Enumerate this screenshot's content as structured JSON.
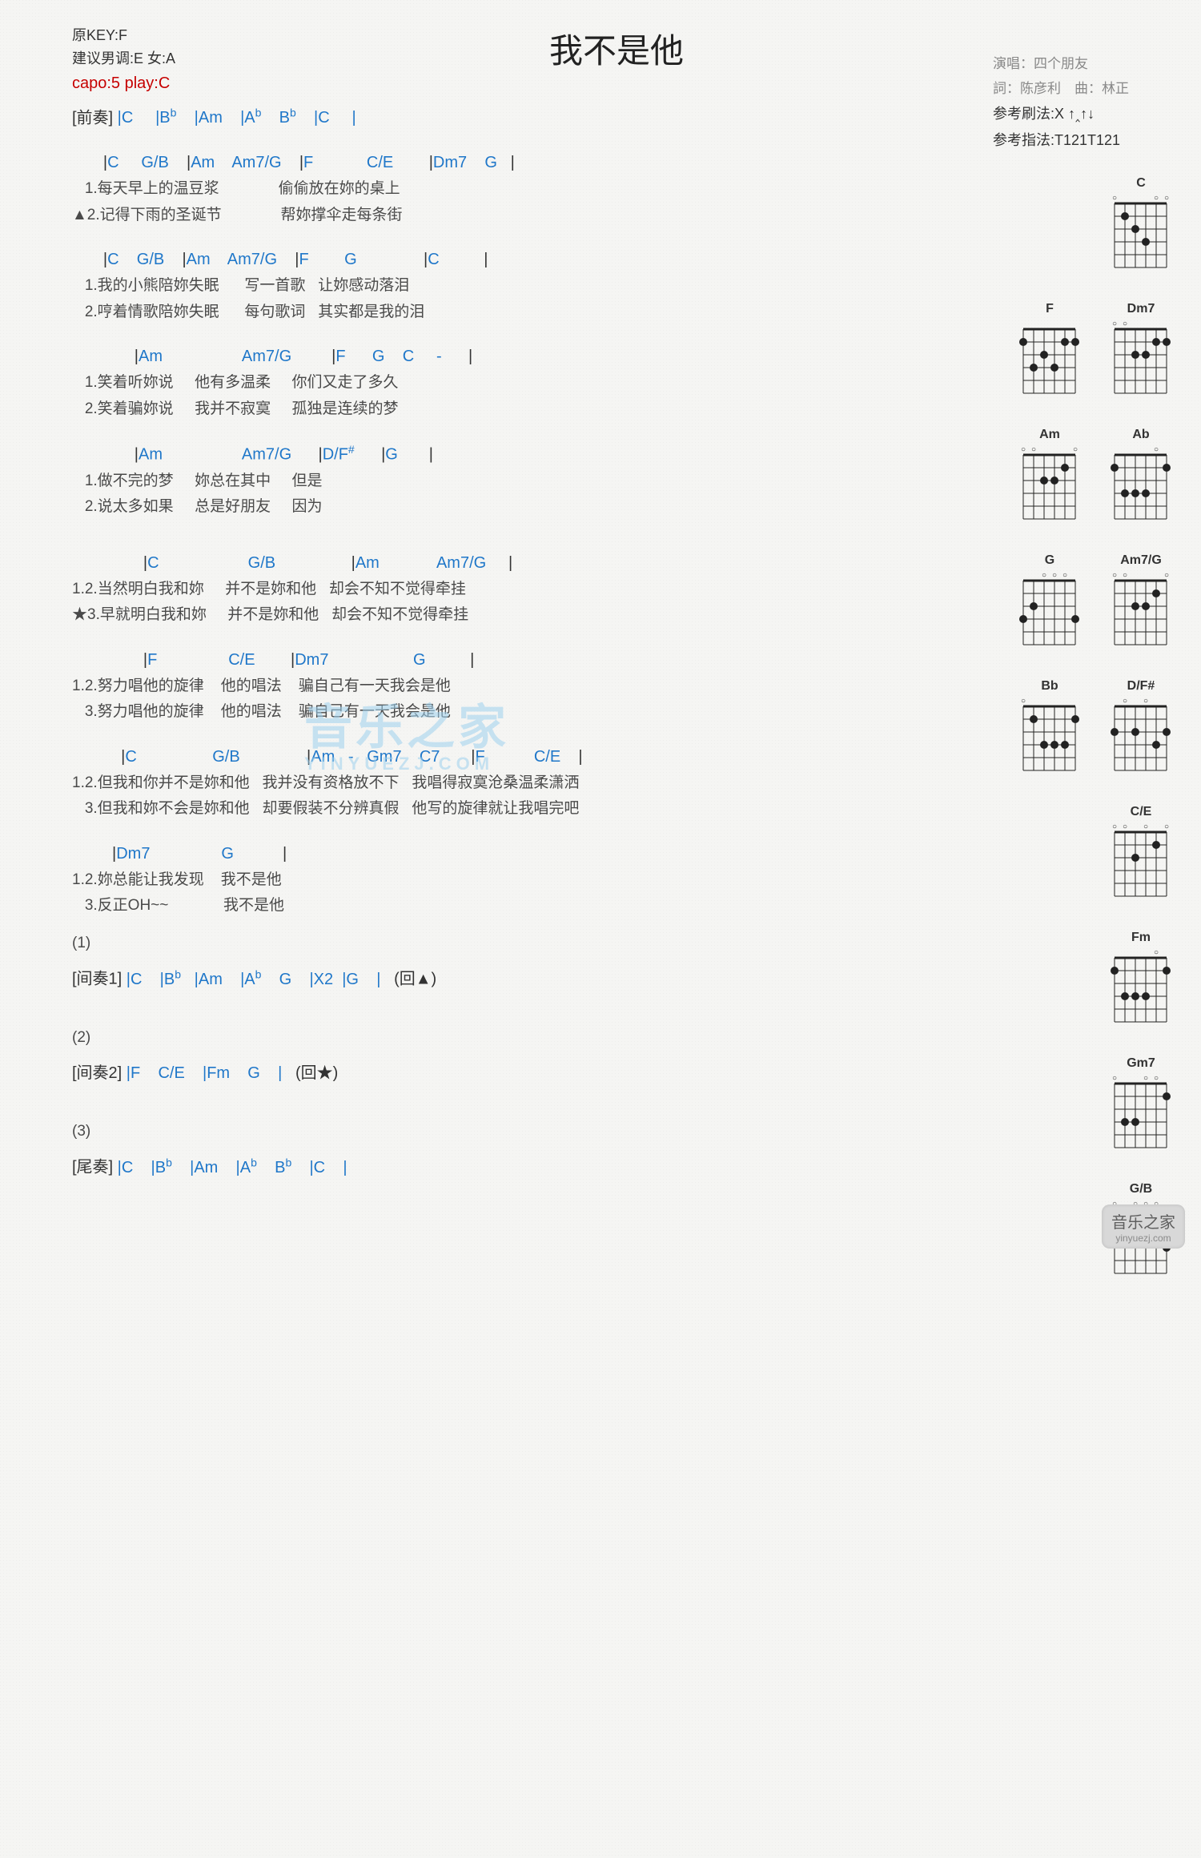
{
  "title": "我不是他",
  "meta": {
    "orig_key": "原KEY:F",
    "suggest": "建议男调:E 女:A",
    "capo": "capo:5 play:C",
    "singer_label": "演唱：",
    "singer": "四个朋友",
    "lyric_label": "詞：",
    "lyricist": "陈彦利",
    "comp_label": "曲：",
    "composer": "林正",
    "strum_label": "参考刷法:",
    "strum": "X ↑‸↑↓",
    "pick_label": "参考指法:",
    "pick": "T121T121"
  },
  "intro_label": "[前奏]",
  "intro_chords": " |C     |B    |Am    |A     B     |C     |",
  "lines": [
    {
      "chords": "       |C     G/B    |Am    Am7/G    |F            C/E        |Dm7    G   |",
      "l1": "   1.每天早上的温豆浆              偷偷放在妳的桌上",
      "l2": "▲2.记得下雨的圣诞节              帮妳撑伞走每条街"
    },
    {
      "chords": "       |C    G/B    |Am    Am7/G    |F        G               |C          |",
      "l1": "   1.我的小熊陪妳失眠      写一首歌   让妳感动落泪",
      "l2": "   2.哼着情歌陪妳失眠      每句歌词   其实都是我的泪"
    },
    {
      "chords": "              |Am                  Am7/G         |F      G    C     -      |",
      "l1": "   1.笑着听妳说     他有多温柔     你们又走了多久",
      "l2": "   2.笑着骗妳说     我并不寂寞     孤独是连续的梦"
    },
    {
      "chords": "              |Am                  Am7/G      |D/F#      |G       |",
      "l1": "   1.做不完的梦     妳总在其中     但是",
      "l2": "   2.说太多如果     总是好朋友     因为"
    },
    {
      "chords": "                |C                    G/B                 |Am             Am7/G     |",
      "l1": "1.2.当然明白我和妳     并不是妳和他   却会不知不觉得牵挂",
      "l2": "★3.早就明白我和妳     并不是妳和他   却会不知不觉得牵挂"
    },
    {
      "chords": "                |F                C/E        |Dm7                   G          |",
      "l1": "1.2.努力唱他的旋律    他的唱法    骗自己有一天我会是他",
      "l2": "   3.努力唱他的旋律    他的唱法    骗自己有一天我会是他"
    },
    {
      "chords": "           |C                 G/B               |Am   -   Gm7    C7       |F           C/E    |",
      "l1": "1.2.但我和你并不是妳和他   我并没有资格放不下   我唱得寂寞沧桑温柔潇洒",
      "l2": "   3.但我和妳不会是妳和他   却要假装不分辨真假   他写的旋律就让我唱完吧"
    },
    {
      "chords": "         |Dm7                G           |",
      "l1": "1.2.妳总能让我发现    我不是他",
      "l2": "   3.反正OH~~             我不是他"
    }
  ],
  "marker1": "(1)",
  "inter1_label": "[间奏1]",
  "inter1": " |C    |B   |Am    |A    G    |X2  |G    |   (回▲)",
  "marker2": "(2)",
  "inter2_label": "[间奏2]",
  "inter2": " |F    C/E    |Fm    G    |   (回★)",
  "marker3": "(3)",
  "outro_label": "[尾奏]",
  "outro": " |C    |B    |Am    |A    B    |C    |",
  "diagrams": [
    [
      "C"
    ],
    [
      "F",
      "Dm7"
    ],
    [
      "Am",
      "Ab"
    ],
    [
      "G",
      "Am7/G"
    ],
    [
      "Bb",
      "D/F#"
    ],
    [
      "C/E"
    ],
    [
      "Fm"
    ],
    [
      "Gm7"
    ],
    [
      "G/B"
    ]
  ],
  "watermark_main": "音乐之家",
  "watermark_sub": "YINYUEZJ.COM",
  "footer_main": "音乐之家",
  "footer_sub": "yinyuezj.com"
}
